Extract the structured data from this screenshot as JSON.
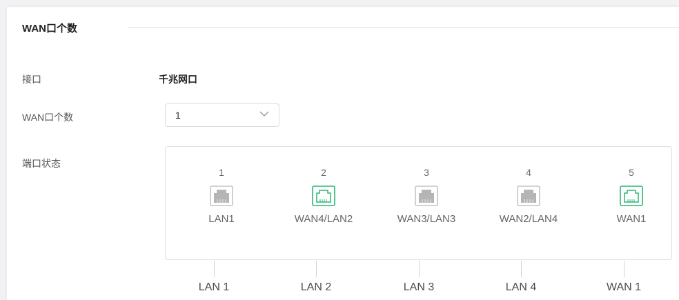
{
  "section": {
    "title": "WAN口个数"
  },
  "fields": {
    "interface_label": "接口",
    "interface_value": "千兆网口",
    "wan_count_label": "WAN口个数",
    "wan_count_value": "1",
    "port_status_label": "端口状态"
  },
  "ports": [
    {
      "num": "1",
      "label": "LAN1",
      "state": "inactive",
      "icon": "ethernet-port-icon"
    },
    {
      "num": "2",
      "label": "WAN4/LAN2",
      "state": "active",
      "icon": "ethernet-port-icon"
    },
    {
      "num": "3",
      "label": "WAN3/LAN3",
      "state": "inactive",
      "icon": "ethernet-port-icon"
    },
    {
      "num": "4",
      "label": "WAN2/LAN4",
      "state": "inactive",
      "icon": "ethernet-port-icon"
    },
    {
      "num": "5",
      "label": "WAN1",
      "state": "active",
      "icon": "ethernet-port-icon"
    }
  ],
  "physical_labels": [
    "LAN 1",
    "LAN 2",
    "LAN 3",
    "LAN 4",
    "WAN 1"
  ],
  "colors": {
    "active_port": "#2bb673",
    "inactive_port": "#c4c4c4"
  }
}
